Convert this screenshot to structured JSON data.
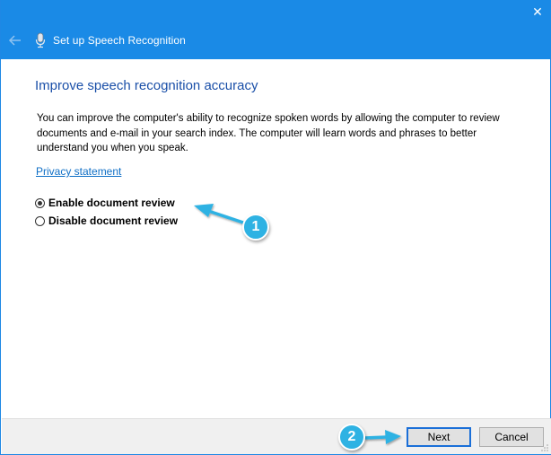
{
  "window": {
    "title": "Set up Speech Recognition",
    "close_glyph": "✕",
    "titlebar_color": "#1a8ae6"
  },
  "icons": {
    "back": "back-arrow-icon",
    "mic": "microphone-icon",
    "close": "close-icon"
  },
  "content": {
    "heading": "Improve speech recognition accuracy",
    "description": "You can improve the computer's ability to recognize spoken words by allowing the computer to review documents and e-mail in your search index. The computer will learn words and phrases to better understand you when you speak.",
    "privacy_link": "Privacy statement",
    "options": [
      {
        "label": "Enable document review",
        "selected": true
      },
      {
        "label": "Disable document review",
        "selected": false
      }
    ]
  },
  "footer": {
    "next_label": "Next",
    "cancel_label": "Cancel"
  },
  "annotations": {
    "step1": "1",
    "step2": "2",
    "color": "#2eb2e3"
  }
}
